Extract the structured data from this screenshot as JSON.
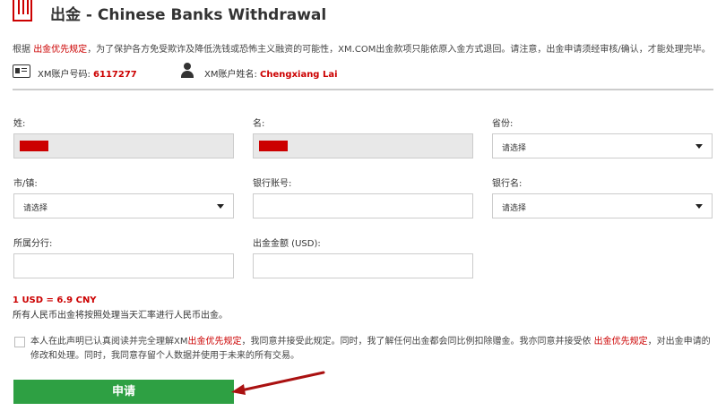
{
  "header": {
    "title": "出金 - Chinese Banks Withdrawal"
  },
  "notice": {
    "prefix": "根据 ",
    "link": "出金优先规定",
    "suffix": "，为了保护各方免受欺诈及降低洗钱或恐怖主义融资的可能性，XM.COM出金款项只能依原入金方式退回。请注意，出金申请须经审核/确认，才能处理完毕。"
  },
  "account": {
    "number_label": "XM账户号码:",
    "number_value": "6117277",
    "name_label": "XM账户姓名:",
    "name_value": "Chengxiang Lai"
  },
  "form": {
    "last_name_label": "姓:",
    "first_name_label": "名:",
    "province_label": "省份:",
    "province_value": "请选择",
    "city_label": "市/镇:",
    "city_value": "请选择",
    "bank_account_label": "银行账号:",
    "bank_name_label": "银行名:",
    "bank_name_value": "请选择",
    "branch_label": "所属分行:",
    "amount_label": "出金金额 (USD):"
  },
  "rate": {
    "text": "1 USD = 6.9 CNY",
    "note": "所有人民币出金将按照处理当天汇率进行人民币出金。"
  },
  "agreement": {
    "part1": "本人在此声明已认真阅读并完全理解XM",
    "link1": "出金优先规定",
    "part2": "，我同意并接受此规定。同时，我了解任何出金都会同比例扣除赠金。我亦同意并接受依 ",
    "link2": "出金优先规定",
    "part3": "，对出金申请的修改和处理。同时，我同意存留个人数据并使用于未来的所有交易。"
  },
  "submit_label": "申请",
  "colors": {
    "brand_red": "#cc0000",
    "submit_green": "#2ea043",
    "arrow": "#aa1111"
  }
}
